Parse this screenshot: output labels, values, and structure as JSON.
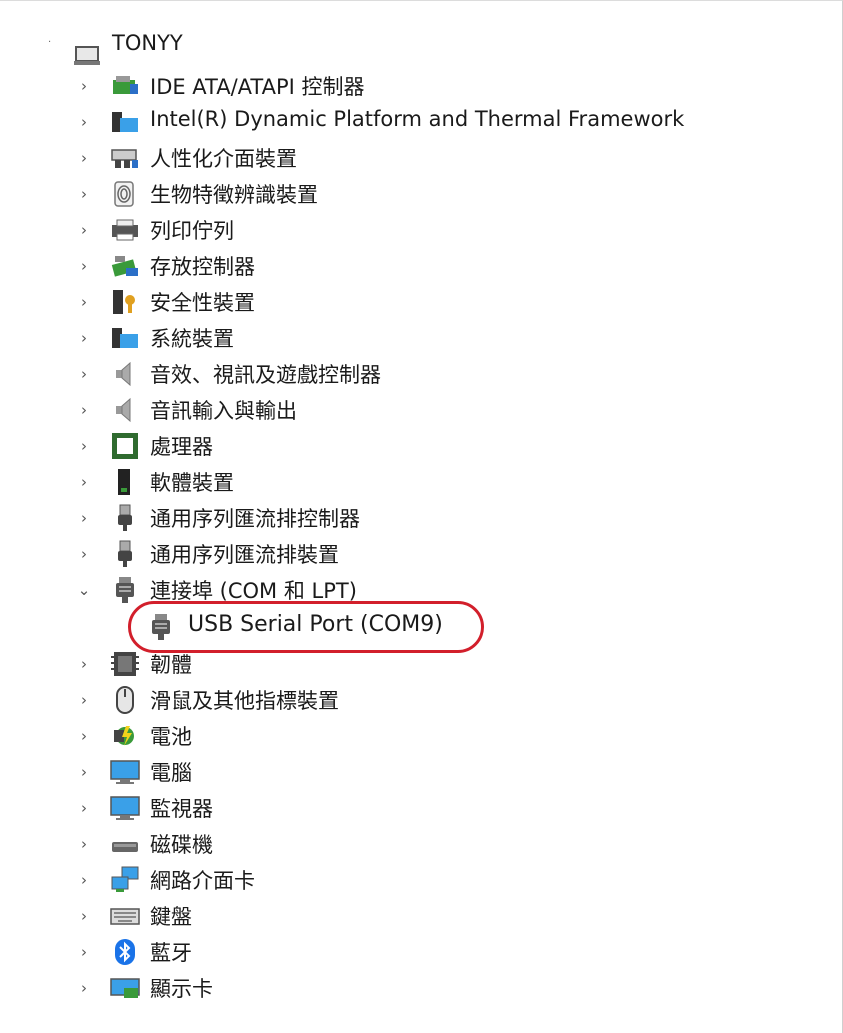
{
  "tree": {
    "root": {
      "label": "TONYY",
      "icon": "computer-icon"
    },
    "categories": [
      {
        "label": "IDE ATA/ATAPI 控制器",
        "icon": "ide-controller-icon",
        "expanded": false
      },
      {
        "label": "Intel(R) Dynamic Platform and Thermal Framework",
        "icon": "system-folder-icon",
        "expanded": false
      },
      {
        "label": "人性化介面裝置",
        "icon": "hid-device-icon",
        "expanded": false
      },
      {
        "label": "生物特徵辨識裝置",
        "icon": "fingerprint-icon",
        "expanded": false
      },
      {
        "label": "列印佇列",
        "icon": "printer-icon",
        "expanded": false
      },
      {
        "label": "存放控制器",
        "icon": "storage-controller-icon",
        "expanded": false
      },
      {
        "label": "安全性裝置",
        "icon": "security-device-icon",
        "expanded": false
      },
      {
        "label": "系統裝置",
        "icon": "system-folder-icon",
        "expanded": false
      },
      {
        "label": "音效、視訊及遊戲控制器",
        "icon": "speaker-icon",
        "expanded": false
      },
      {
        "label": "音訊輸入與輸出",
        "icon": "speaker-icon",
        "expanded": false
      },
      {
        "label": "處理器",
        "icon": "processor-icon",
        "expanded": false
      },
      {
        "label": "軟體裝置",
        "icon": "software-device-icon",
        "expanded": false
      },
      {
        "label": "通用序列匯流排控制器",
        "icon": "usb-plug-icon",
        "expanded": false
      },
      {
        "label": "通用序列匯流排裝置",
        "icon": "usb-plug-icon",
        "expanded": false
      },
      {
        "label": "連接埠 (COM 和 LPT)",
        "icon": "port-connector-icon",
        "expanded": true,
        "children": [
          {
            "label": "USB Serial Port (COM9)",
            "icon": "port-connector-icon",
            "highlighted": true
          }
        ]
      },
      {
        "label": "韌體",
        "icon": "firmware-chip-icon",
        "expanded": false
      },
      {
        "label": "滑鼠及其他指標裝置",
        "icon": "mouse-icon",
        "expanded": false
      },
      {
        "label": "電池",
        "icon": "battery-icon",
        "expanded": false
      },
      {
        "label": "電腦",
        "icon": "monitor-icon",
        "expanded": false
      },
      {
        "label": "監視器",
        "icon": "monitor-icon",
        "expanded": false
      },
      {
        "label": "磁碟機",
        "icon": "disk-drive-icon",
        "expanded": false
      },
      {
        "label": "網路介面卡",
        "icon": "network-adapter-icon",
        "expanded": false
      },
      {
        "label": "鍵盤",
        "icon": "keyboard-icon",
        "expanded": false
      },
      {
        "label": "藍牙",
        "icon": "bluetooth-icon",
        "expanded": false
      },
      {
        "label": "顯示卡",
        "icon": "display-adapter-icon",
        "expanded": false
      }
    ]
  },
  "colors": {
    "highlight_ring": "#d21f2b",
    "text": "#1a1a1a",
    "chevron": "#555555"
  }
}
